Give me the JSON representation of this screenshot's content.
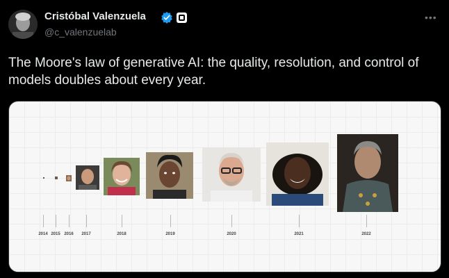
{
  "author": {
    "name": "Cristóbal Valenzuela",
    "handle": "@c_valenzuelab",
    "verified_icon": "verified-badge-icon",
    "affiliation_icon": "runway-affiliate-badge-icon"
  },
  "more_icon": "more-dots-icon",
  "tweet": {
    "text": "The Moore's law of generative AI: the quality, resolution, and control of models doubles about every year."
  },
  "media": {
    "timeline_years": [
      "2014",
      "2015",
      "2016",
      "2017",
      "2018",
      "2019",
      "2020",
      "2021",
      "2022"
    ]
  },
  "colors": {
    "background": "#000000",
    "text": "#e7e9ea",
    "secondary": "#71767b",
    "verified": "#1d9bf0"
  }
}
